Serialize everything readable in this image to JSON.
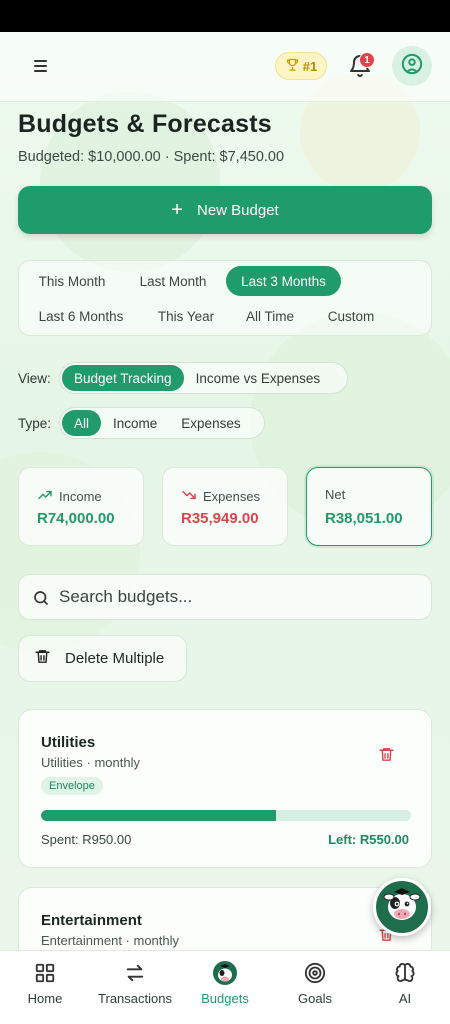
{
  "header": {
    "rank_label": "#1",
    "notification_count": "1"
  },
  "page": {
    "title": "Budgets & Forecasts",
    "subtitle": "Budgeted: $10,000.00 · Spent: $7,450.00",
    "new_budget_label": "New Budget"
  },
  "periods": {
    "row1": [
      "This Month",
      "Last Month",
      "Last 3 Months"
    ],
    "row2": [
      "Last 6 Months",
      "This Year",
      "All Time",
      "Custom"
    ],
    "selected": "Last 3 Months"
  },
  "view": {
    "label": "View:",
    "options": [
      "Budget Tracking",
      "Income vs Expenses"
    ],
    "selected": "Budget Tracking"
  },
  "type": {
    "label": "Type:",
    "options": [
      "All",
      "Income",
      "Expenses"
    ],
    "selected": "All"
  },
  "stats": {
    "income": {
      "label": "Income",
      "value": "R74,000.00",
      "color": "#1f9b6c"
    },
    "expenses": {
      "label": "Expenses",
      "value": "R35,949.00",
      "color": "#e0434b"
    },
    "net": {
      "label": "Net",
      "value": "R38,051.00",
      "color": "#1f9b6c"
    }
  },
  "search": {
    "placeholder": "Search budgets..."
  },
  "delete_multiple_label": "Delete Multiple",
  "budgets": [
    {
      "name": "Utilities",
      "category": "Utilities · monthly",
      "tag": "Envelope",
      "progress": 0.635,
      "spent": "Spent: R950.00",
      "left": "Left: R550.00"
    },
    {
      "name": "Entertainment",
      "category": "Entertainment · monthly"
    }
  ],
  "nav": {
    "items": [
      "Home",
      "Transactions",
      "Budgets",
      "Goals",
      "AI"
    ],
    "active": "Budgets"
  },
  "colors": {
    "accent": "#1f9b6c",
    "danger": "#e0434b",
    "gold": "#b58a00"
  }
}
